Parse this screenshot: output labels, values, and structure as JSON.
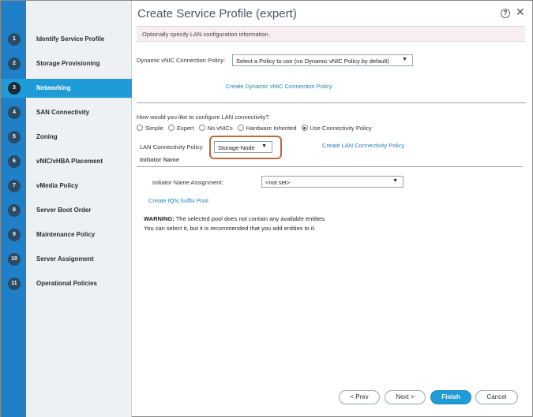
{
  "dialog": {
    "title": "Create Service Profile (expert)",
    "help_glyph": "?",
    "close_glyph": "✕",
    "info": "Optionally specify LAN configuration information."
  },
  "steps": [
    {
      "num": "1",
      "label": "Identify Service Profile",
      "active": false
    },
    {
      "num": "2",
      "label": "Storage Provisioning",
      "active": false
    },
    {
      "num": "3",
      "label": "Networking",
      "active": true
    },
    {
      "num": "4",
      "label": "SAN Connectivity",
      "active": false
    },
    {
      "num": "5",
      "label": "Zoning",
      "active": false
    },
    {
      "num": "6",
      "label": "vNIC/vHBA Placement",
      "active": false
    },
    {
      "num": "7",
      "label": "vMedia Policy",
      "active": false
    },
    {
      "num": "8",
      "label": "Server Boot Order",
      "active": false
    },
    {
      "num": "9",
      "label": "Maintenance Policy",
      "active": false
    },
    {
      "num": "10",
      "label": "Server Assignment",
      "active": false
    },
    {
      "num": "11",
      "label": "Operational Policies",
      "active": false
    }
  ],
  "dynamic_vnic": {
    "label": "Dynamic vNIC Connection Policy:",
    "value": "Select a Policy to use (no Dynamic vNIC Policy by default)",
    "create_link": "Create Dynamic vNIC Connection Policy"
  },
  "lan": {
    "question": "How would you like to configure LAN connectivity?",
    "options": [
      {
        "label": "Simple",
        "selected": false
      },
      {
        "label": "Expert",
        "selected": false
      },
      {
        "label": "No vNICs",
        "selected": false
      },
      {
        "label": "Hardware Inherited",
        "selected": false
      },
      {
        "label": "Use Connectivity Policy",
        "selected": true
      }
    ],
    "policy_label": "LAN Connectivity Policy",
    "policy_value": "Storage-Node",
    "create_link": "Create LAN Connectivity Policy"
  },
  "initiator": {
    "section_title": "Initiator Name",
    "assignment_label": "Initiator Name Assignment:",
    "assignment_value": "<not set>",
    "create_link": "Create IQN Suffix Pool"
  },
  "warning": {
    "prefix": "WARNING:",
    "line1": " The selected pool does not contain any available entities.",
    "line2": "You can select it, but it is recommended that you add entities to it."
  },
  "buttons": {
    "prev": "< Prev",
    "next": "Next >",
    "finish": "Finish",
    "cancel": "Cancel"
  },
  "glyphs": {
    "caret": "▼"
  },
  "colors": {
    "accent": "#1f9bd8",
    "rail": "#1f7fc7",
    "highlight": "#b86b3e",
    "link": "#1f7fb5"
  }
}
